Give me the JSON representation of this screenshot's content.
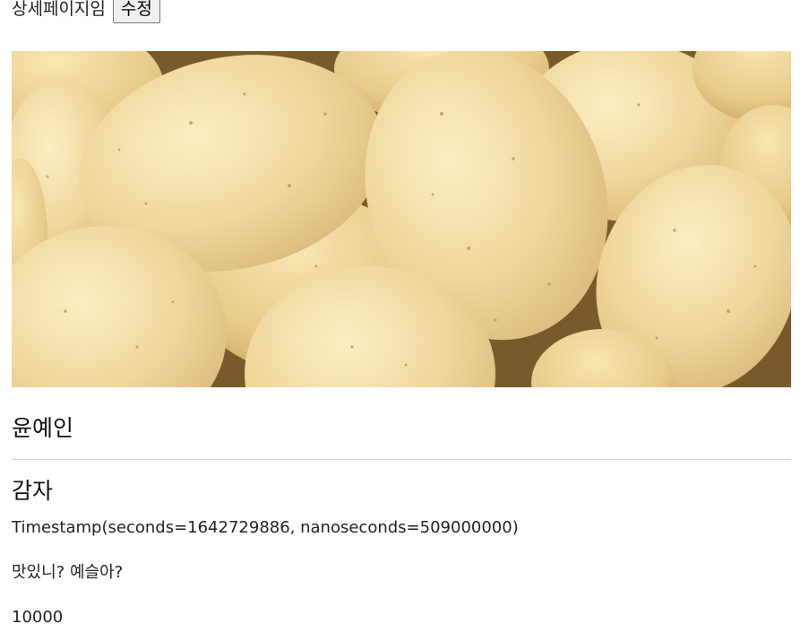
{
  "header": {
    "page_label": "상세페이지임",
    "edit_button": "수정"
  },
  "product": {
    "image_subject": "potatoes",
    "seller": "윤예인",
    "title": "감자",
    "timestamp": "Timestamp(seconds=1642729886, nanoseconds=509000000)",
    "description": "맛있니? 예슬아?",
    "price": "10000"
  },
  "colors": {
    "divider": "#cfcfcf",
    "potato_skin": "#f1d9a0",
    "potato_shadow": "#c9a96a"
  }
}
